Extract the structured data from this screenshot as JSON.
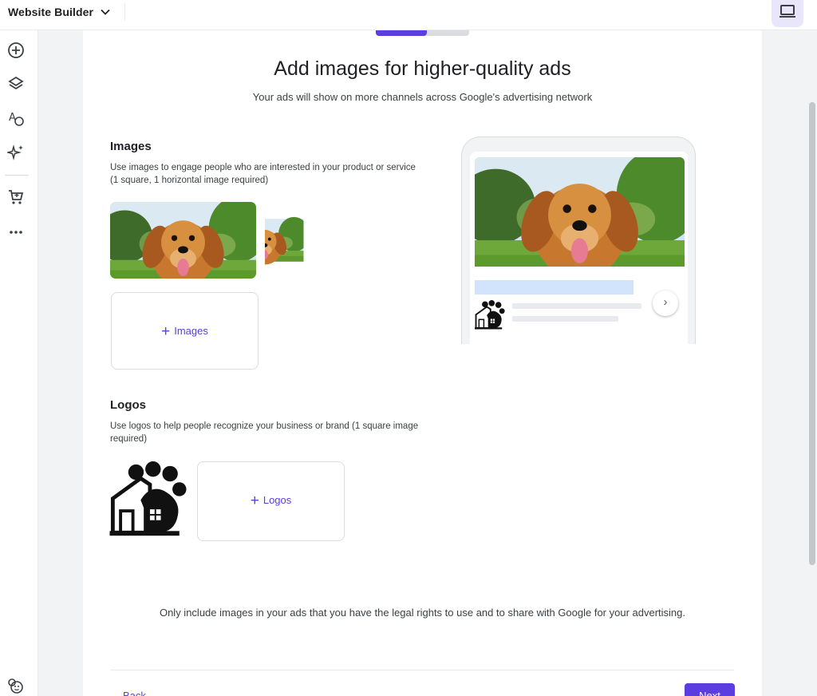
{
  "app": {
    "title": "Website Builder",
    "accent": "#5b3de0"
  },
  "rail": {
    "icons": [
      "add-circle-icon",
      "layers-icon",
      "typography-palette-icon",
      "sparkle-icon",
      "cart-icon",
      "more-horizontal-icon",
      "face-emoji-icon"
    ]
  },
  "progress": {
    "fraction": 0.55
  },
  "header": {
    "title": "Add images for higher-quality ads",
    "subtitle": "Your ads will show on more channels across Google's advertising network"
  },
  "images_section": {
    "heading": "Images",
    "description": "Use images to engage people who are interested in your product or service (1 square, 1 horizontal image required)",
    "add_label": "Images"
  },
  "logos_section": {
    "heading": "Logos",
    "description": "Use logos to help people recognize your business or brand (1 square image required)",
    "add_label": "Logos"
  },
  "disclaimer": "Only include images in your ads that you have the legal rights to use and to share with Google for your advertising.",
  "footer": {
    "back_label": "Back",
    "next_label": "Next"
  }
}
